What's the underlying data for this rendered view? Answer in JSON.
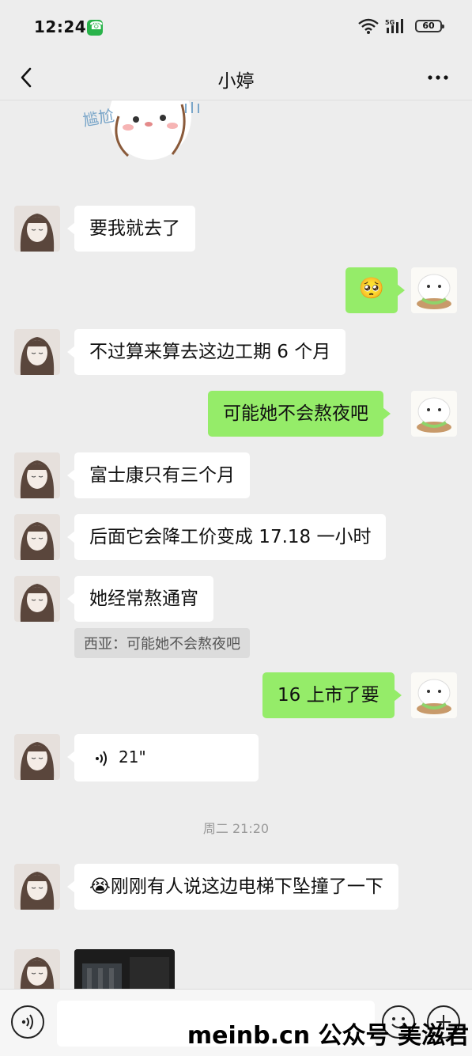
{
  "status_bar": {
    "time": "12:24",
    "network": "5G",
    "battery": "60"
  },
  "nav": {
    "title": "小婷"
  },
  "messages": [
    {
      "side": "left",
      "type": "text",
      "text": "要我就去了"
    },
    {
      "side": "right",
      "type": "emoji",
      "emoji": "🥺"
    },
    {
      "side": "left",
      "type": "text",
      "text": "不过算来算去这边工期 6 个月"
    },
    {
      "side": "right",
      "type": "text",
      "text": "可能她不会熬夜吧"
    },
    {
      "side": "left",
      "type": "text",
      "text": "富士康只有三个月"
    },
    {
      "side": "left",
      "type": "text",
      "text": "后面它会降工价变成 17.18 一小时"
    },
    {
      "side": "left",
      "type": "text",
      "text": "她经常熬通宵",
      "quote": "西亚：可能她不会熬夜吧"
    },
    {
      "side": "right",
      "type": "text",
      "text": "16 上市了要"
    },
    {
      "side": "left",
      "type": "voice",
      "duration": "21\""
    },
    {
      "type": "timestamp",
      "text": "周二 21:20"
    },
    {
      "side": "left",
      "type": "text",
      "emoji": "😭",
      "text": "刚刚有人说这边电梯下坠撞了一下"
    },
    {
      "side": "left",
      "type": "image"
    }
  ],
  "sticker": {
    "text": "尴尬"
  },
  "watermark": "meinb.cn  公众号 美滋君",
  "colors": {
    "green_bubble": "#95ec69",
    "background": "#ededed"
  }
}
